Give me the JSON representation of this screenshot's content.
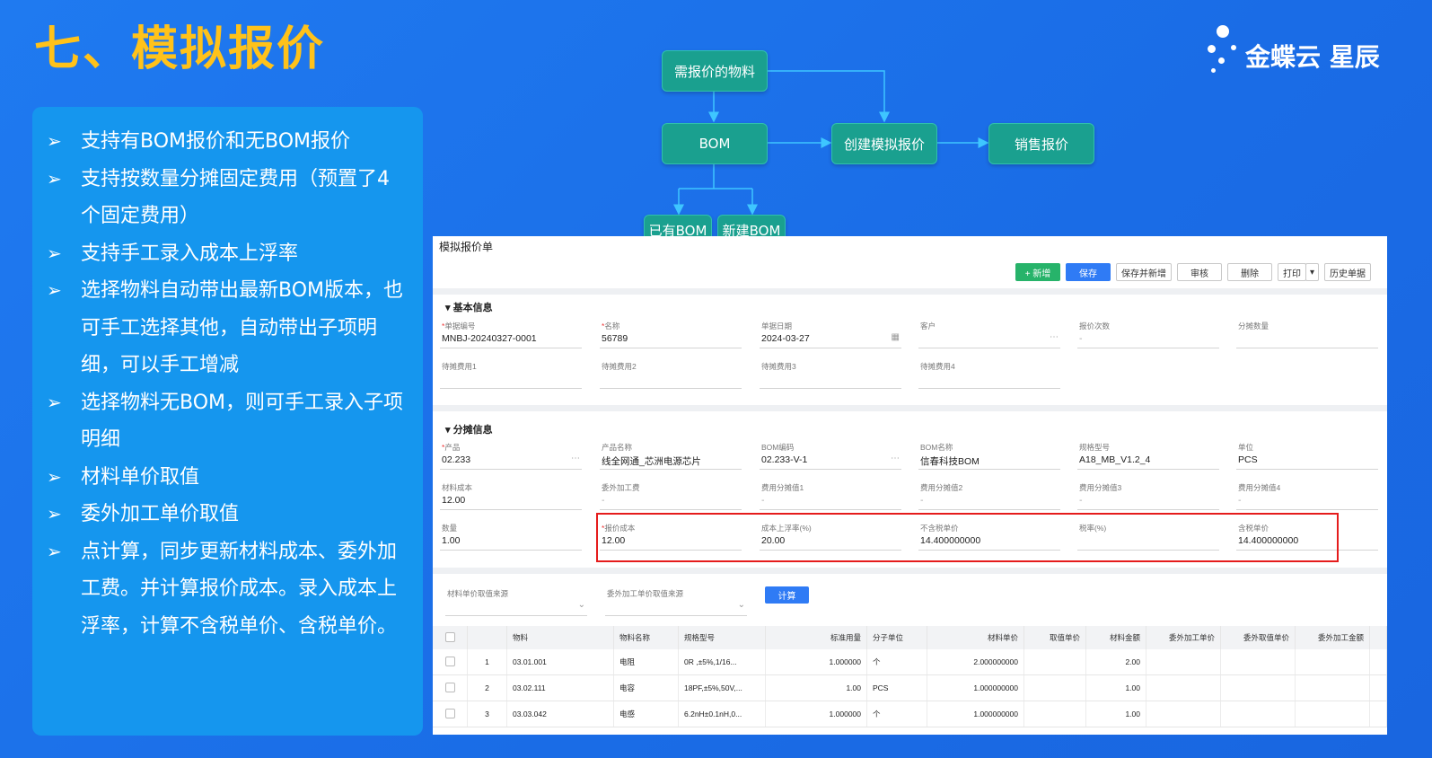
{
  "slide": {
    "title": "七、模拟报价",
    "brand": "金蝶云 星辰",
    "bullets": [
      "支持有BOM报价和无BOM报价",
      "支持按数量分摊固定费用（预置了4个固定费用）",
      "支持手工录入成本上浮率",
      "选择物料自动带出最新BOM版本，也可手工选择其他，自动带出子项明细，可以手工增减",
      "选择物料无BOM，则可手工录入子项明细",
      "材料单价取值",
      "委外加工单价取值",
      "点计算，同步更新材料成本、委外加工费。并计算报价成本。录入成本上浮率，计算不含税单价、含税单价。"
    ],
    "bullet_icon": "arrow-bullet-icon"
  },
  "flow": {
    "nodes": {
      "material": "需报价的物料",
      "bom": "BOM",
      "create": "创建模拟报价",
      "sales": "销售报价",
      "existing_bom": "已有BOM",
      "new_bom": "新建BOM"
    },
    "node_color": "#1aa08f",
    "arrow_color": "#3ec6ff"
  },
  "app": {
    "window_title": "模拟报价单",
    "toolbar": {
      "new": "+ 新增",
      "save": "保存",
      "save_new": "保存并新增",
      "audit": "审核",
      "delete": "删除",
      "print": "打印",
      "history": "历史单据"
    },
    "basic": {
      "header": "▾ 基本信息",
      "fields": [
        {
          "label": "单据编号",
          "required": true,
          "value": "MNBJ-20240327-0001",
          "icon": ""
        },
        {
          "label": "名称",
          "required": true,
          "value": "56789",
          "icon": ""
        },
        {
          "label": "单据日期",
          "required": false,
          "value": "2024-03-27",
          "icon": "calendar-icon"
        },
        {
          "label": "客户",
          "required": false,
          "value": "",
          "icon": "more-icon"
        },
        {
          "label": "报价次数",
          "required": false,
          "value": "-",
          "icon": ""
        },
        {
          "label": "分摊数量",
          "required": false,
          "value": "",
          "icon": ""
        },
        {
          "label": "待摊费用1",
          "required": false,
          "value": "",
          "icon": ""
        },
        {
          "label": "待摊费用2",
          "required": false,
          "value": "",
          "icon": ""
        },
        {
          "label": "待摊费用3",
          "required": false,
          "value": "",
          "icon": ""
        },
        {
          "label": "待摊费用4",
          "required": false,
          "value": "",
          "icon": ""
        }
      ]
    },
    "alloc": {
      "header": "▾ 分摊信息",
      "fields": [
        {
          "label": "产品",
          "required": true,
          "value": "02.233",
          "icon": "more-icon"
        },
        {
          "label": "产品名称",
          "required": false,
          "value": "线全网通_芯洲电源芯片",
          "icon": ""
        },
        {
          "label": "BOM编码",
          "required": false,
          "value": "02.233-V-1",
          "icon": "more-icon"
        },
        {
          "label": "BOM名称",
          "required": false,
          "value": "信春科技BOM",
          "icon": ""
        },
        {
          "label": "规格型号",
          "required": false,
          "value": "A18_MB_V1.2_4",
          "icon": ""
        },
        {
          "label": "单位",
          "required": false,
          "value": "PCS",
          "icon": ""
        },
        {
          "label": "材料成本",
          "required": false,
          "value": "12.00",
          "icon": ""
        },
        {
          "label": "委外加工费",
          "required": false,
          "value": "-",
          "icon": ""
        },
        {
          "label": "费用分摊值1",
          "required": false,
          "value": "-",
          "icon": ""
        },
        {
          "label": "费用分摊值2",
          "required": false,
          "value": "-",
          "icon": ""
        },
        {
          "label": "费用分摊值3",
          "required": false,
          "value": "-",
          "icon": ""
        },
        {
          "label": "费用分摊值4",
          "required": false,
          "value": "-",
          "icon": ""
        },
        {
          "label": "数量",
          "required": false,
          "value": "1.00",
          "icon": ""
        },
        {
          "label": "报价成本",
          "required": true,
          "value": "12.00",
          "icon": ""
        },
        {
          "label": "成本上浮率(%)",
          "required": false,
          "value": "20.00",
          "icon": ""
        },
        {
          "label": "不含税单价",
          "required": false,
          "value": "14.400000000",
          "icon": ""
        },
        {
          "label": "税率(%)",
          "required": false,
          "value": "",
          "icon": ""
        },
        {
          "label": "含税单价",
          "required": false,
          "value": "14.400000000",
          "icon": ""
        }
      ]
    },
    "source": {
      "material_price_label": "材料单价取值来源",
      "outsource_price_label": "委外加工单价取值来源",
      "calc_button": "计算"
    },
    "table": {
      "columns": [
        "",
        "",
        "物料",
        "物料名称",
        "规格型号",
        "标准用量",
        "分子单位",
        "材料单价",
        "取值单价",
        "材料金额",
        "委外加工单价",
        "委外取值单价",
        "委外加工金额"
      ],
      "rows": [
        [
          "",
          "1",
          "03.01.001",
          "电阻",
          "0R ,±5%,1/16...",
          "1.000000",
          "个",
          "2.000000000",
          "",
          "2.00",
          "",
          "",
          ""
        ],
        [
          "",
          "2",
          "03.02.111",
          "电容",
          "18PF,±5%,50V,...",
          "1.00",
          "PCS",
          "1.000000000",
          "",
          "1.00",
          "",
          "",
          ""
        ],
        [
          "",
          "3",
          "03.03.042",
          "电感",
          "6.2nH±0.1nH,0...",
          "1.000000",
          "个",
          "1.000000000",
          "",
          "1.00",
          "",
          "",
          ""
        ]
      ]
    }
  }
}
